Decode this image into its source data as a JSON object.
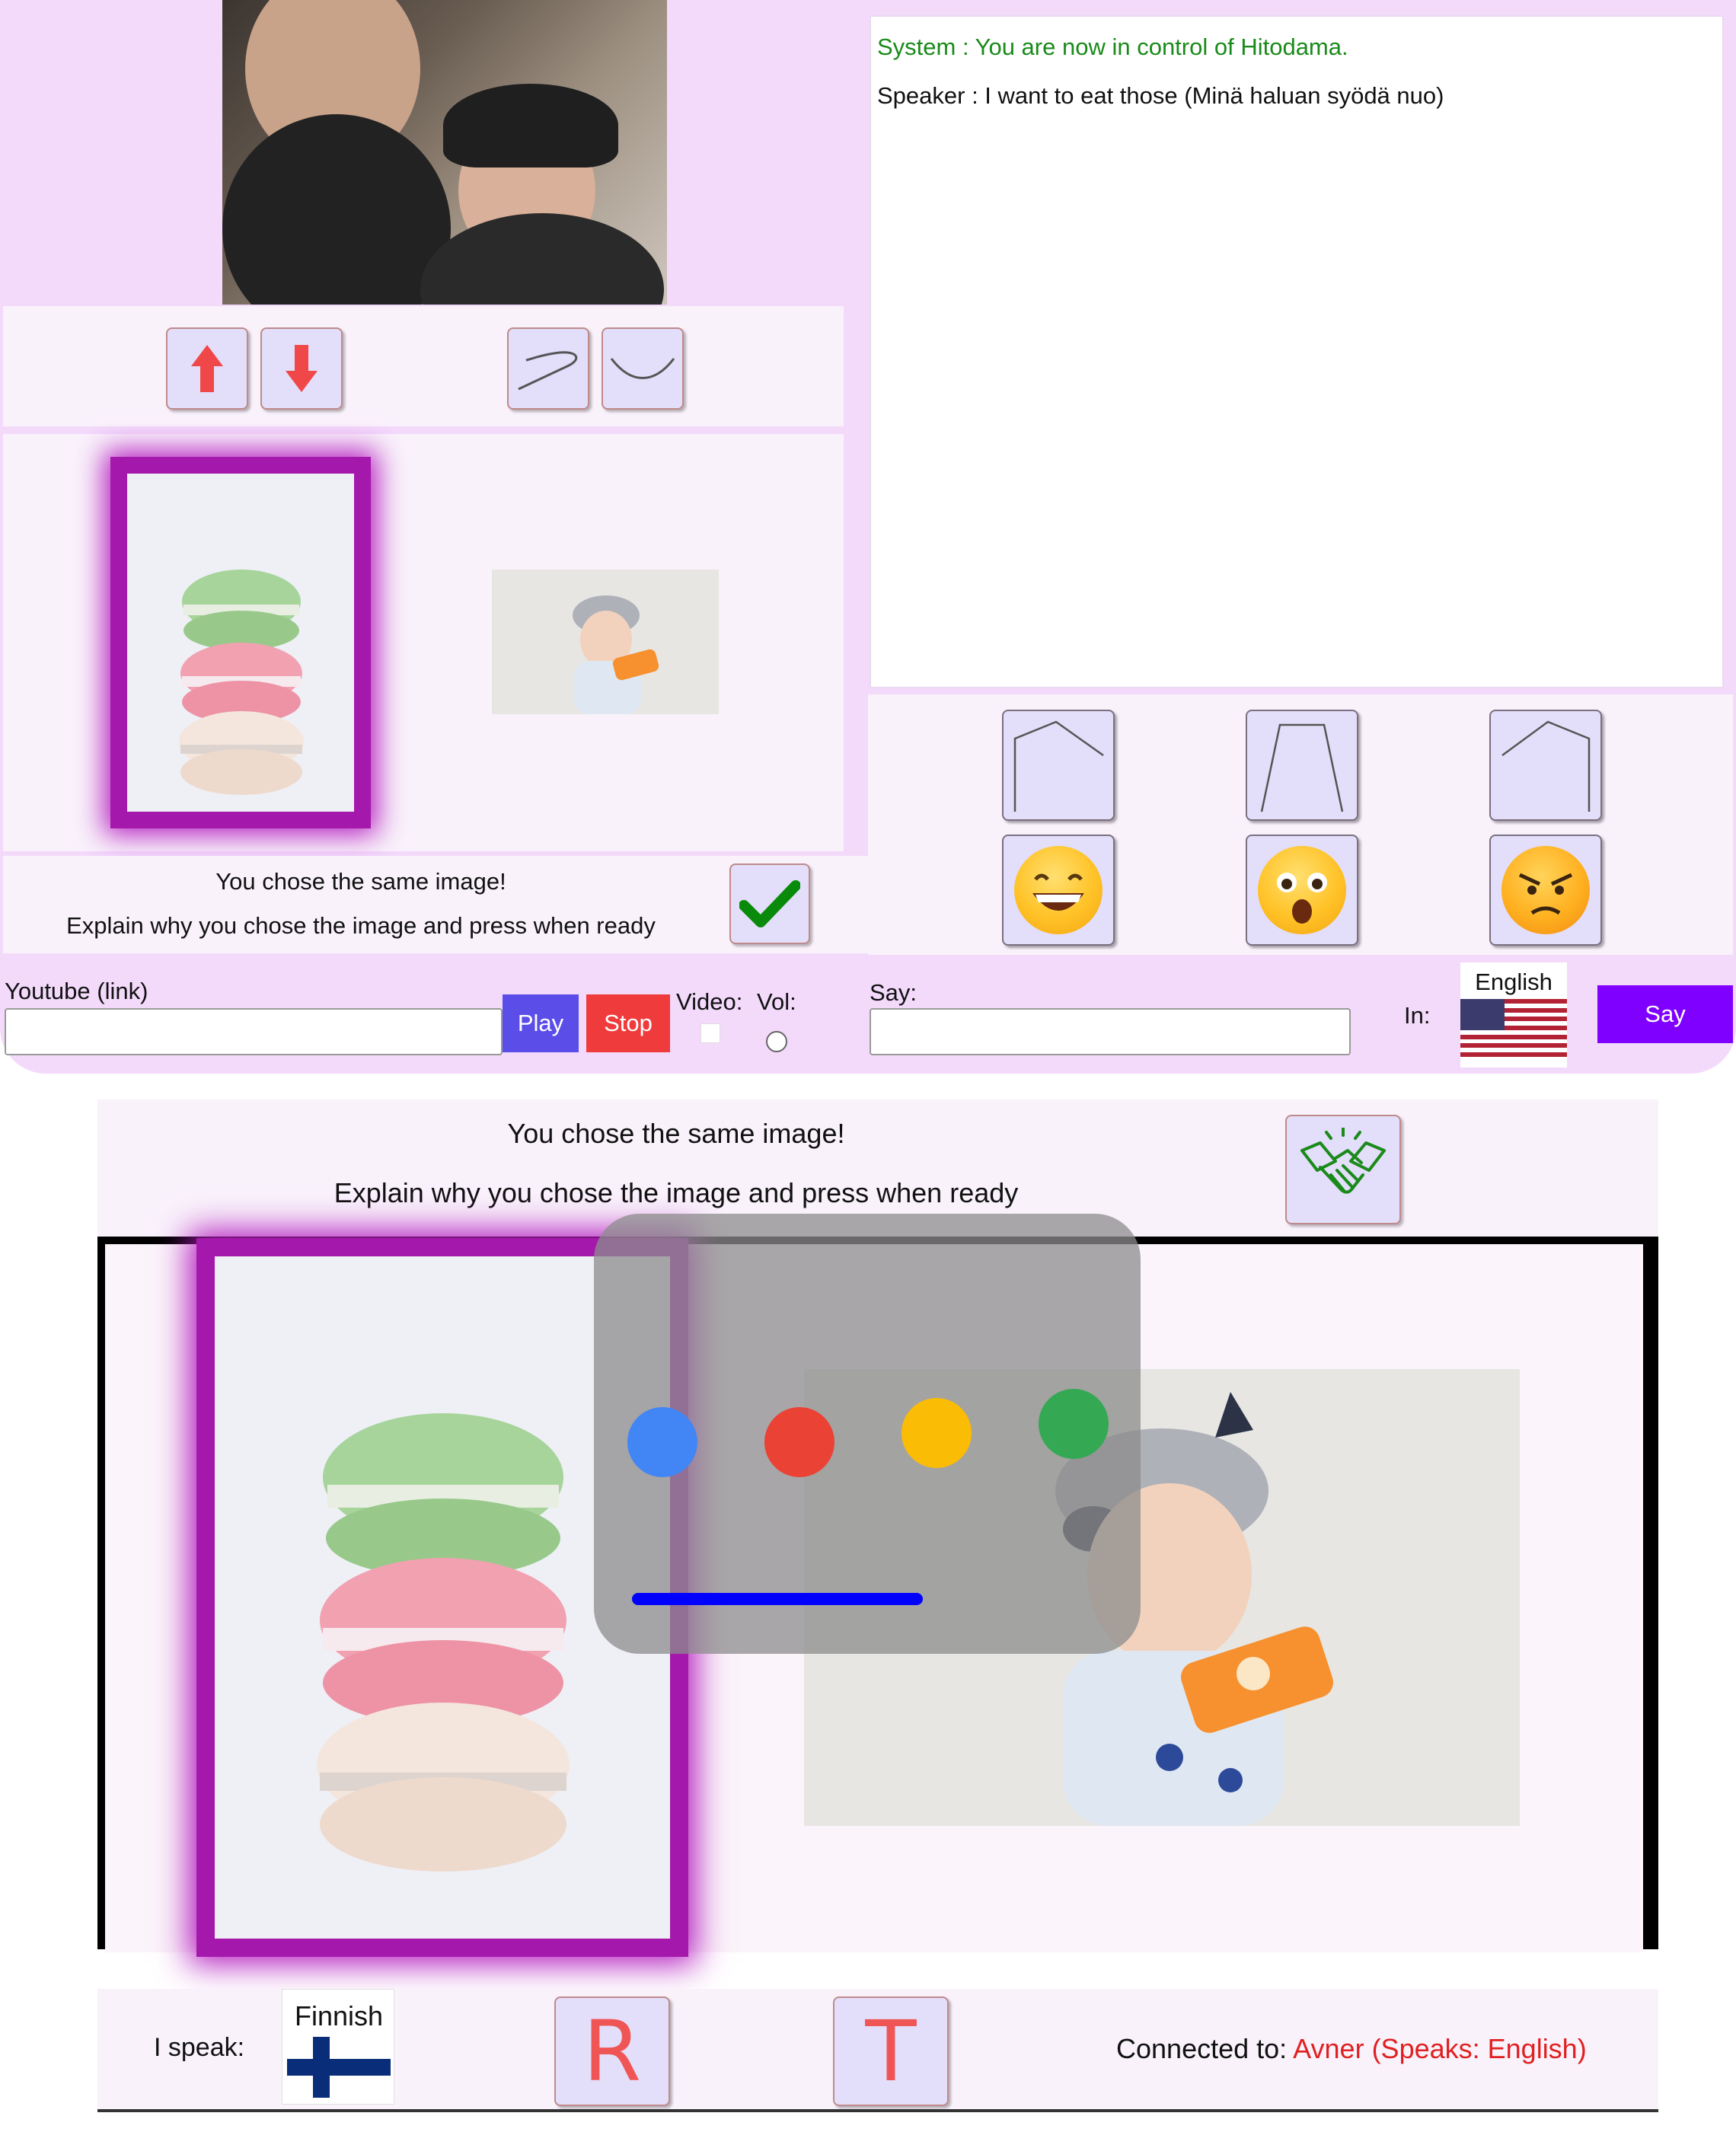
{
  "top": {
    "chat": {
      "system_line": "System : You are now in control of Hitodama.",
      "speaker_line": "Speaker : I want to eat those (Minä haluan syödä nuo)"
    },
    "status": {
      "line1": "You chose the same image!",
      "line2": "Explain why you chose the image and press when ready"
    },
    "controls": {
      "up_icon": "arrow-up-icon",
      "down_icon": "arrow-down-icon",
      "tilt_icon": "eyebrow-tilt-icon",
      "curve_icon": "mouth-curve-icon"
    },
    "faces": {
      "shapes": [
        "shape-pentagon-left-icon",
        "shape-trapezoid-icon",
        "shape-pentagon-right-icon"
      ],
      "emojis": [
        "grinning-face-icon",
        "astonished-face-icon",
        "angry-face-icon"
      ]
    },
    "youtube": {
      "label": "Youtube (link)",
      "value": "",
      "play": "Play",
      "stop": "Stop"
    },
    "video_label": "Video:",
    "vol_label": "Vol:",
    "say": {
      "label": "Say:",
      "value": "",
      "in_label": "In:",
      "language": "English",
      "button": "Say"
    },
    "colors": {
      "panel": "#f3dafb",
      "play": "#5b4ee8",
      "stop": "#ef3b3b",
      "say": "#7f00ff",
      "highlight": "#a418ab",
      "system_text": "#1a8a1a"
    }
  },
  "bottom": {
    "header": {
      "line1": "You chose the same image!",
      "line2": "Explain why you chose the image and press when ready",
      "handshake_icon": "handshake-icon"
    },
    "assistant_dots": [
      "#4285f4",
      "#ea4335",
      "#fbbc05",
      "#34a853"
    ],
    "footer": {
      "speak_label": "I speak:",
      "language": "Finnish",
      "r_button": "R",
      "t_button": "T",
      "connected_label": "Connected to: ",
      "connected_value": "Avner (Speaks: English)"
    }
  }
}
